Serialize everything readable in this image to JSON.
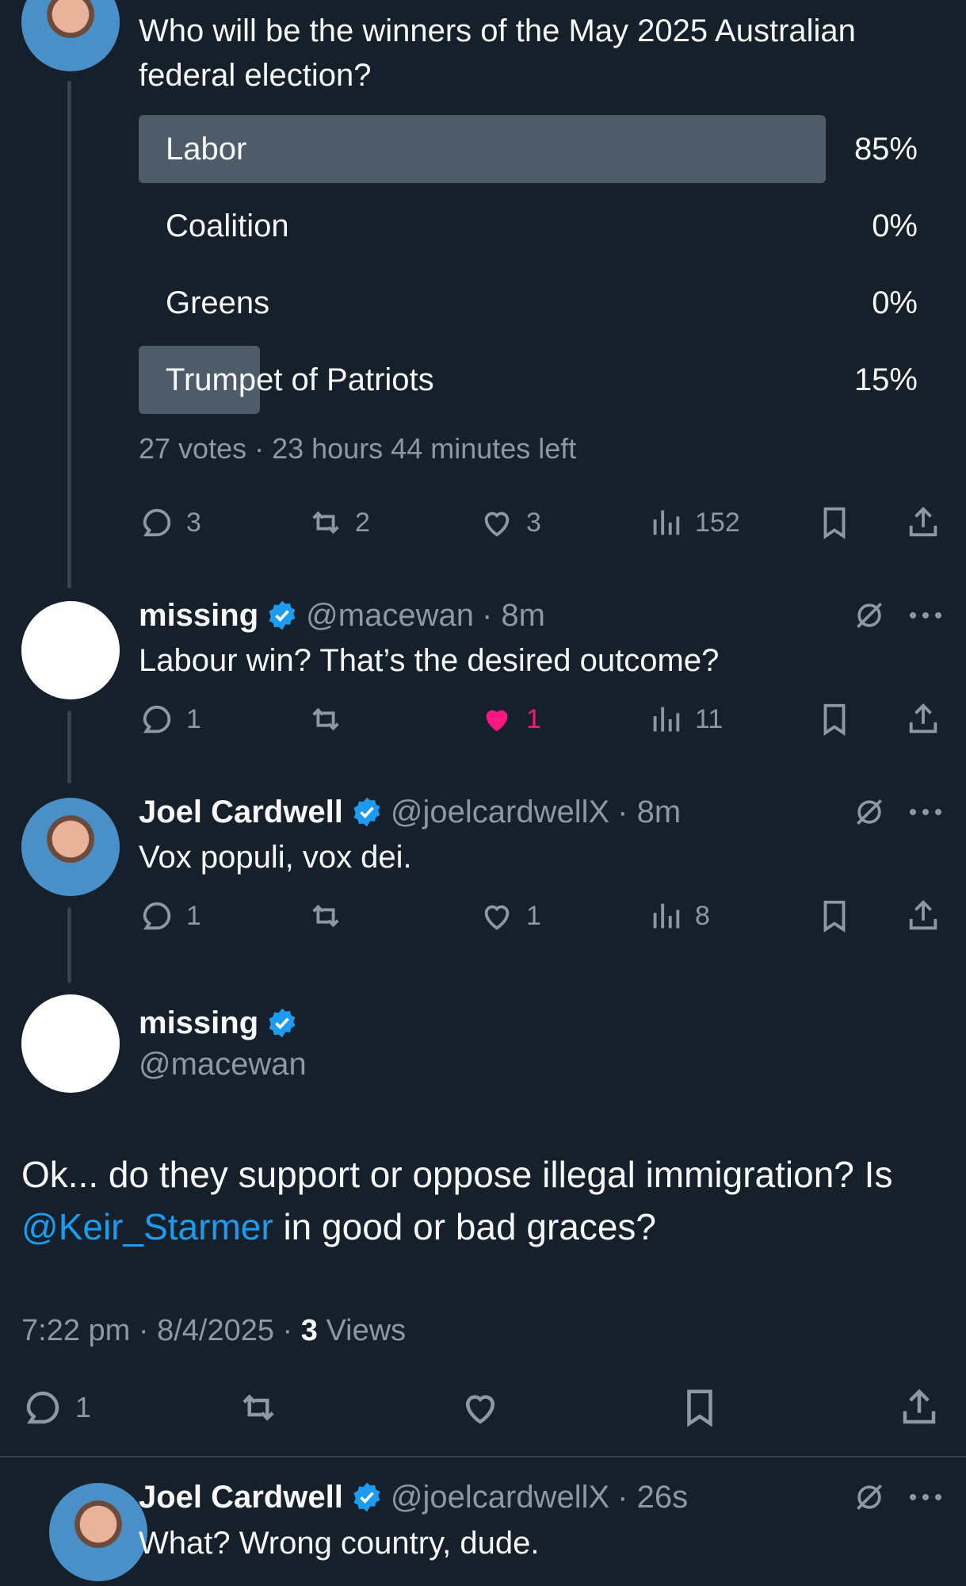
{
  "poll_tweet": {
    "question_line1": "Who will be the winners of the May 2025 Australian",
    "question_line2": "federal election?",
    "options": [
      {
        "label": "Labor",
        "percent": "85%",
        "share": 0.85
      },
      {
        "label": "Coalition",
        "percent": "0%",
        "share": 0
      },
      {
        "label": "Greens",
        "percent": "0%",
        "share": 0
      },
      {
        "label": "Trumpet of Patriots",
        "percent": "15%",
        "share": 0.15
      }
    ],
    "meta": "27 votes · 23 hours 44 minutes left",
    "actions": {
      "replies": "3",
      "reposts": "2",
      "likes": "3",
      "views": "152"
    }
  },
  "reply1": {
    "name": "missing",
    "handle": "@macewan",
    "time": "· 8m",
    "text": "Labour win? That’s the desired outcome?",
    "actions": {
      "replies": "1",
      "reposts": "",
      "likes": "1",
      "views": "11"
    },
    "liked": true
  },
  "reply2": {
    "name": "Joel Cardwell",
    "handle": "@joelcardwellX",
    "time": "· 8m",
    "text": "Vox populi, vox dei.",
    "actions": {
      "replies": "1",
      "reposts": "",
      "likes": "1",
      "views": "8"
    }
  },
  "main_tweet": {
    "name": "missing",
    "handle": "@macewan",
    "text_line1": "Ok... do they support or oppose illegal immigration? Is",
    "mention": "@Keir_Starmer",
    "text_line2_rest": " in good or bad graces?",
    "time_date": "7:22 pm · 8/4/2025 · ",
    "views_count": "3",
    "views_label": " Views",
    "actions": {
      "replies": "1"
    }
  },
  "reply3": {
    "name": "Joel Cardwell",
    "handle": "@joelcardwellX",
    "time": "· 26s",
    "text": "What? Wrong country, dude."
  },
  "colors": {
    "background": "#15202b",
    "muted": "#8b98a5",
    "accent": "#1d9bf0",
    "like": "#f91880",
    "poll_fill": "#4e5c6a"
  }
}
